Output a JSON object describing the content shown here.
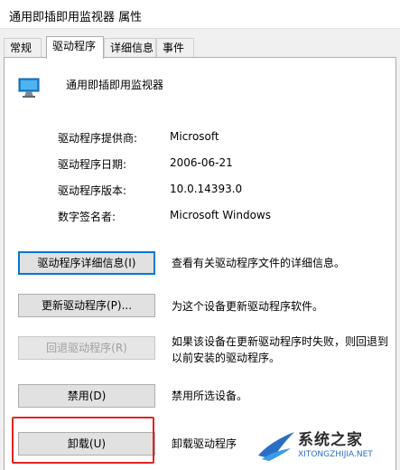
{
  "window": {
    "title": "通用即插即用监视器 属性"
  },
  "tabs": [
    {
      "label": "常规"
    },
    {
      "label": "驱动程序"
    },
    {
      "label": "详细信息"
    },
    {
      "label": "事件"
    }
  ],
  "device": {
    "name": "通用即插即用监视器",
    "icon": "monitor-icon"
  },
  "info": [
    {
      "label": "驱动程序提供商:",
      "value": "Microsoft"
    },
    {
      "label": "驱动程序日期:",
      "value": "2006-06-21"
    },
    {
      "label": "驱动程序版本:",
      "value": "10.0.14393.0"
    },
    {
      "label": "数字签名者:",
      "value": "Microsoft Windows"
    }
  ],
  "buttons": [
    {
      "label": "驱动程序详细信息(I)",
      "desc": "查看有关驱动程序文件的详细信息。"
    },
    {
      "label": "更新驱动程序(P)...",
      "desc": "为这个设备更新驱动程序软件。"
    },
    {
      "label": "回退驱动程序(R)",
      "desc": "如果该设备在更新驱动程序时失败，则回退到以前安装的驱动程序。"
    },
    {
      "label": "禁用(D)",
      "desc": "禁用所选设备。"
    },
    {
      "label": "卸载(U)",
      "desc": "卸载驱动程序"
    }
  ],
  "watermark": {
    "text": "系统之家",
    "url": "XITONGZHIJIA.NET"
  }
}
